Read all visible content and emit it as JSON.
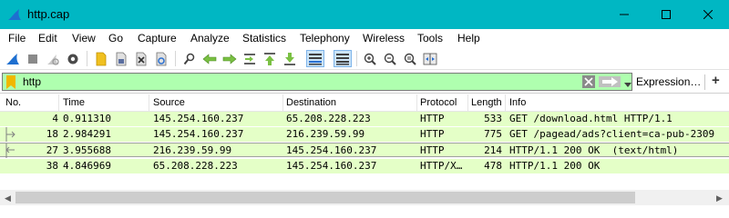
{
  "window": {
    "title": "http.cap",
    "controls": [
      "minimize",
      "maximize",
      "close"
    ]
  },
  "menu": [
    "File",
    "Edit",
    "View",
    "Go",
    "Capture",
    "Analyze",
    "Statistics",
    "Telephony",
    "Wireless",
    "Tools",
    "Help"
  ],
  "toolbar": {
    "buttons": [
      "shark-fin-start-icon",
      "stop-icon",
      "restart-icon",
      "options-gear-icon",
      "open-file-icon",
      "save-file-icon",
      "close-file-icon",
      "reload-icon",
      "find-icon",
      "go-back-icon",
      "go-forward-icon",
      "go-to-packet-icon",
      "first-packet-icon",
      "last-packet-icon",
      "autoscroll-icon",
      "colorize-icon",
      "zoom-in-icon",
      "zoom-out-icon",
      "normal-size-icon",
      "resize-columns-icon"
    ],
    "active": [
      "autoscroll-icon",
      "colorize-icon"
    ]
  },
  "filter": {
    "value": "http",
    "background": "#afffaf",
    "expression_label": "Expression…",
    "add_label": "+"
  },
  "packet_list": {
    "columns": [
      "No.",
      "Time",
      "Source",
      "Destination",
      "Protocol",
      "Length",
      "Info"
    ],
    "rows": [
      {
        "no": "4",
        "time": "0.911310",
        "source": "145.254.160.237",
        "destination": "65.208.228.223",
        "protocol": "HTTP",
        "length": "533",
        "info": "GET /download.html HTTP/1.1"
      },
      {
        "no": "18",
        "time": "2.984291",
        "source": "145.254.160.237",
        "destination": "216.239.59.99",
        "protocol": "HTTP",
        "length": "775",
        "info": "GET /pagead/ads?client=ca-pub-2309"
      },
      {
        "no": "27",
        "time": "3.955688",
        "source": "216.239.59.99",
        "destination": "145.254.160.237",
        "protocol": "HTTP",
        "length": "214",
        "info": "HTTP/1.1 200 OK  (text/html)"
      },
      {
        "no": "38",
        "time": "4.846969",
        "source": "65.208.228.223",
        "destination": "145.254.160.237",
        "protocol": "HTTP/X…",
        "length": "478",
        "info": "HTTP/1.1 200 OK"
      }
    ],
    "row_color": "#e4ffc7",
    "selected_row": "27"
  }
}
